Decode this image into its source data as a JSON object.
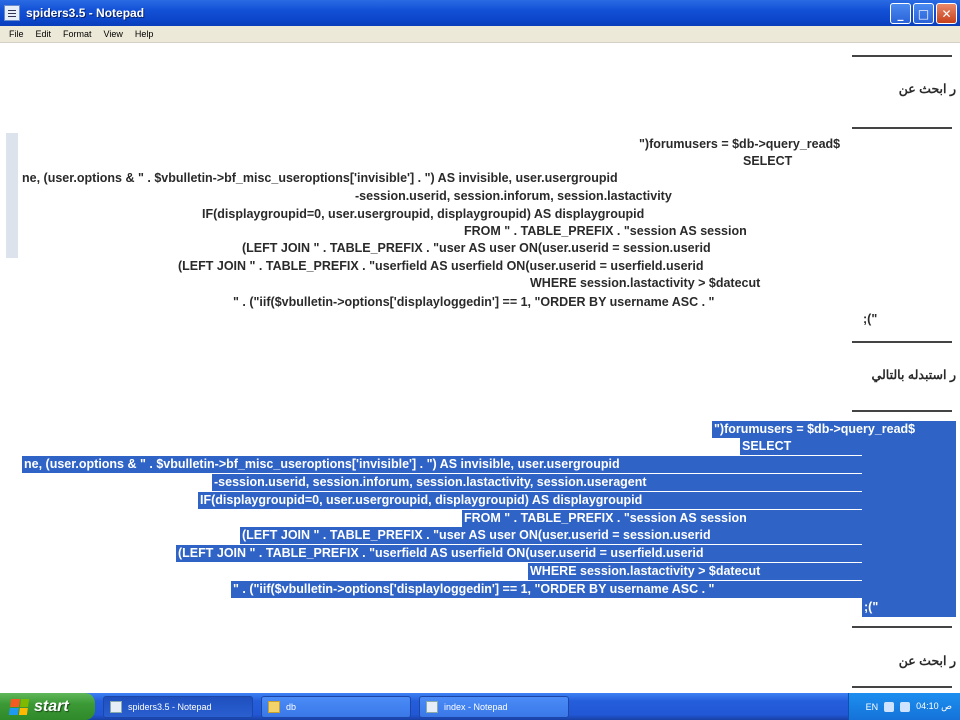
{
  "window": {
    "title": "spiders3.5 - Notepad"
  },
  "menu": [
    "File",
    "Edit",
    "Format",
    "View",
    "Help"
  ],
  "editor": {
    "section1_heading": "ر ابحث عن",
    "block1": [
      "\")forumusers = $db->query_read$",
      "SELECT",
      "ne, (user.options & \" . $vbulletin->bf_misc_useroptions['invisible'] . \") AS invisible, user.usergroupid",
      "-session.userid, session.inforum, session.lastactivity",
      "IF(displaygroupid=0, user.usergroupid, displaygroupid) AS displaygroupid",
      "FROM \" . TABLE_PREFIX . \"session AS session",
      "(LEFT JOIN \" . TABLE_PREFIX . \"user AS user ON(user.userid = session.userid",
      "(LEFT JOIN \" . TABLE_PREFIX . \"userfield AS userfield ON(user.userid = userfield.userid",
      "WHERE session.lastactivity > $datecut",
      "\" . (\"iif($vbulletin->options['displayloggedin'] == 1, \"ORDER BY username ASC . \"",
      ";(\""
    ],
    "section2_heading": "ر استبدله بالتالي",
    "block2": [
      "\")forumusers = $db->query_read$",
      "SELECT",
      "ne, (user.options & \" . $vbulletin->bf_misc_useroptions['invisible'] . \") AS invisible, user.usergroupid",
      "-session.userid, session.inforum, session.lastactivity, session.useragent",
      "IF(displaygroupid=0, user.usergroupid, displaygroupid) AS displaygroupid",
      "FROM \" . TABLE_PREFIX . \"session AS session",
      "(LEFT JOIN \" . TABLE_PREFIX . \"user AS user ON(user.userid = session.userid",
      "(LEFT JOIN \" . TABLE_PREFIX . \"userfield AS userfield ON(user.userid = userfield.userid",
      "WHERE session.lastactivity > $datecut",
      "\" . (\"iif($vbulletin->options['displayloggedin'] == 1, \"ORDER BY username ASC . \"",
      ";(\""
    ],
    "section3_heading": "ر ابحث عن"
  },
  "taskbar": {
    "start_label": "start",
    "tasks": [
      {
        "label": "spiders3.5 - Notepad",
        "icon": "notepad-icon",
        "active": true
      },
      {
        "label": "db",
        "icon": "folder-icon",
        "active": false
      },
      {
        "label": "index - Notepad",
        "icon": "notepad-icon",
        "active": false
      }
    ],
    "tray": {
      "lang": "EN",
      "time": "04:10 ص"
    }
  },
  "colors": {
    "selection": "#2f63c6",
    "titlebar": "#0c45c8",
    "taskbar": "#245edb"
  }
}
